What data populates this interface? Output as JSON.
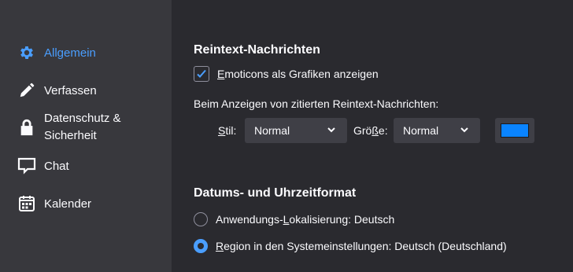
{
  "sidebar": {
    "items": [
      {
        "label": "Allgemein",
        "icon": "gear-icon",
        "active": true
      },
      {
        "label": "Verfassen",
        "icon": "pencil-icon"
      },
      {
        "label": "Datenschutz &",
        "label2": "Sicherheit",
        "icon": "lock-icon"
      },
      {
        "label": "Chat",
        "icon": "chat-icon"
      },
      {
        "label": "Kalender",
        "icon": "calendar-icon"
      }
    ]
  },
  "plaintext": {
    "title": "Reintext-Nachrichten",
    "emoticons_key": "E",
    "emoticons_rest": "moticons als Grafiken anzeigen",
    "emoticons_checked": true,
    "quoted_label": "Beim Anzeigen von zitierten Reintext-Nachrichten:",
    "style_key": "S",
    "style_rest": "til:",
    "style_value": "Normal",
    "size_pre": "Grö",
    "size_key": "ß",
    "size_rest": "e:",
    "size_value": "Normal",
    "color": "#0a84ff"
  },
  "datetime": {
    "title": "Datums- und Uhrzeitformat",
    "option1_pre": "Anwendungs-",
    "option1_key": "L",
    "option1_rest": "okalisierung: Deutsch",
    "option2_key": "R",
    "option2_rest": "egion in den Systemeinstellungen: Deutsch (Deutschland)",
    "selected": 2
  },
  "colors": {
    "accent": "#4a9eff",
    "sidebar_bg": "#38383d",
    "main_bg": "#2a2a2f"
  }
}
